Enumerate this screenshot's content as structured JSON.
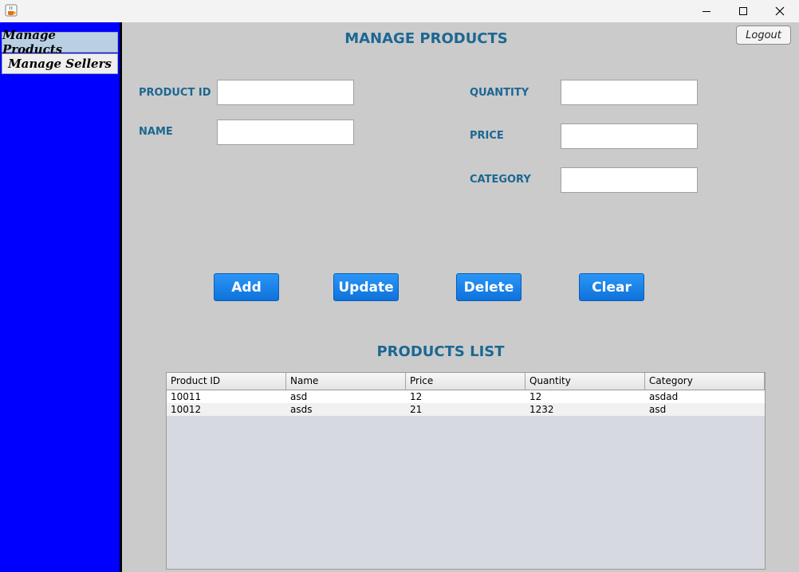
{
  "window": {
    "icon": "java-cup-icon",
    "controls": [
      "minimize",
      "maximize",
      "close"
    ]
  },
  "sidebar": {
    "items": [
      {
        "label": "Manage Products",
        "active": true
      },
      {
        "label": "Manage Sellers",
        "active": false
      }
    ]
  },
  "header": {
    "title": "MANAGE PRODUCTS",
    "logout_label": "Logout"
  },
  "form": {
    "product_id_label": "PRODUCT ID",
    "name_label": "NAME",
    "quantity_label": "QUANTITY",
    "price_label": "PRICE",
    "category_label": "CATEGORY",
    "product_id_value": "",
    "name_value": "",
    "quantity_value": "",
    "price_value": "",
    "category_value": ""
  },
  "actions": {
    "add": "Add",
    "update": "Update",
    "delete": "Delete",
    "clear": "Clear"
  },
  "products_list": {
    "title": "PRODUCTS LIST",
    "columns": [
      "Product ID",
      "Name",
      "Price",
      "Quantity",
      "Category"
    ],
    "rows": [
      [
        "10011",
        "asd",
        "12",
        "12",
        "asdad"
      ],
      [
        "10012",
        "asds",
        "21",
        "1232",
        "asd"
      ]
    ]
  },
  "colors": {
    "sidebar_bg": "#0000ff",
    "panel_bg": "#cbcbcb",
    "heading": "#1c6792",
    "button_bg": "#1a82ec",
    "table_empty_bg": "#d6d9df"
  }
}
